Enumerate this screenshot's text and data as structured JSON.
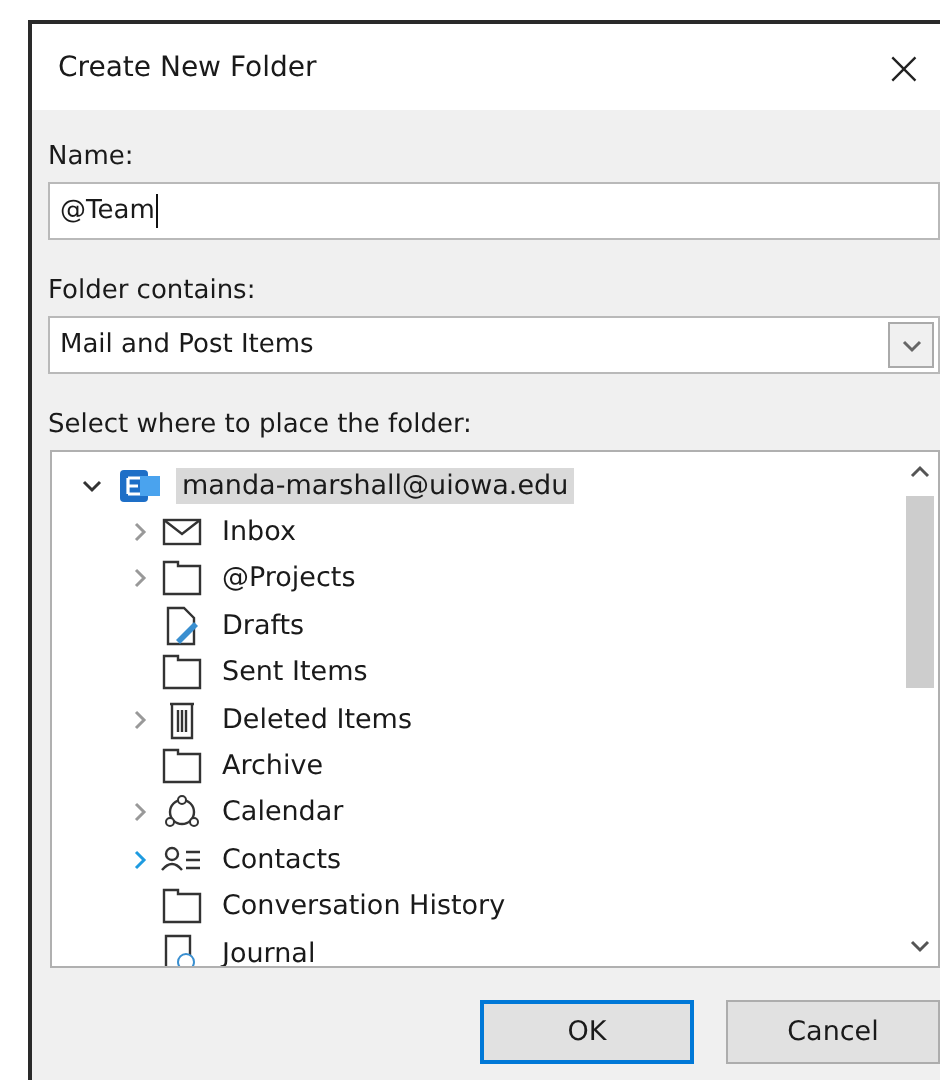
{
  "window": {
    "title": "Create New Folder",
    "close": "×"
  },
  "name_field": {
    "label": "Name:",
    "value": "@Team"
  },
  "contains_field": {
    "label": "Folder contains:",
    "value": "Mail and Post Items"
  },
  "tree": {
    "label": "Select where to place the folder:",
    "root": {
      "label": "manda-marshall@uiowa.edu",
      "selected": true,
      "expanded": true,
      "children": [
        {
          "label": "Inbox",
          "kind": "mail",
          "expandable": true,
          "hovered": false
        },
        {
          "label": "@Projects",
          "kind": "folder",
          "expandable": true,
          "hovered": false
        },
        {
          "label": "Drafts",
          "kind": "drafts",
          "expandable": false
        },
        {
          "label": "Sent Items",
          "kind": "folder",
          "expandable": false
        },
        {
          "label": "Deleted Items",
          "kind": "trash",
          "expandable": true,
          "hovered": false
        },
        {
          "label": "Archive",
          "kind": "folder",
          "expandable": false
        },
        {
          "label": "Calendar",
          "kind": "calendar",
          "expandable": true,
          "hovered": false
        },
        {
          "label": "Contacts",
          "kind": "contacts",
          "expandable": true,
          "hovered": true
        },
        {
          "label": "Conversation History",
          "kind": "folder",
          "expandable": false
        },
        {
          "label": "Journal",
          "kind": "journal",
          "expandable": false
        }
      ]
    }
  },
  "buttons": [
    {
      "label": "OK",
      "default": true
    },
    {
      "label": "Cancel",
      "default": false
    }
  ]
}
